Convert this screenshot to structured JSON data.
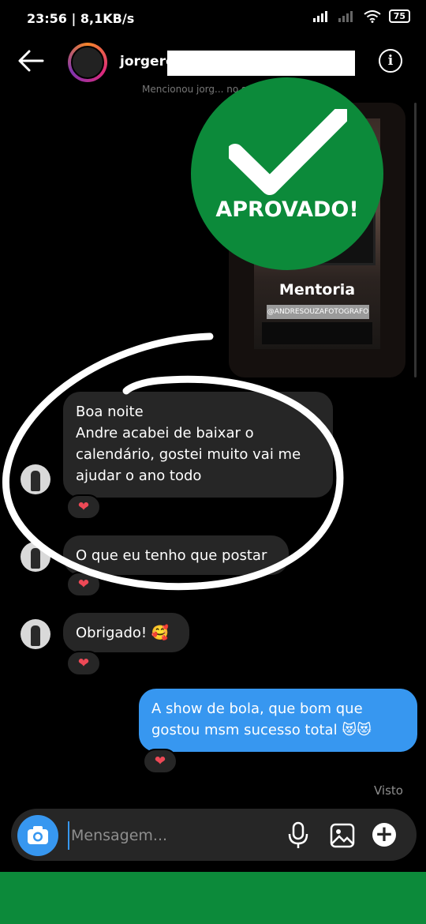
{
  "status_bar": {
    "text": "23:56 | 8,1KB/s",
    "battery": "75"
  },
  "header": {
    "username": "jorgero"
  },
  "story": {
    "caption": "Mencionou jorg... no seu story",
    "title": "Mentoria",
    "mention": "@ANDRESOUZAFOTOGRAFO"
  },
  "overlay": {
    "stamp_text": "APROVADO!"
  },
  "messages": [
    {
      "lines": [
        "Boa noite",
        "Andre acabei de baixar o",
        "calendário, gostei muito vai me",
        "ajudar o ano todo"
      ]
    },
    {
      "lines": [
        "O que eu tenho que postar"
      ]
    },
    {
      "lines": [
        "Obrigado! 🥰"
      ]
    },
    {
      "lines": [
        "A show de bola, que bom que",
        "gostou msm sucesso total 😻😻"
      ]
    }
  ],
  "reactions": {
    "emoji": "❤"
  },
  "seen_label": "Visto",
  "composer": {
    "placeholder": "Mensagem..."
  },
  "colors": {
    "accent": "#3797f0",
    "stamp_green": "#0c8a3a",
    "bubble_dark": "#262626"
  }
}
